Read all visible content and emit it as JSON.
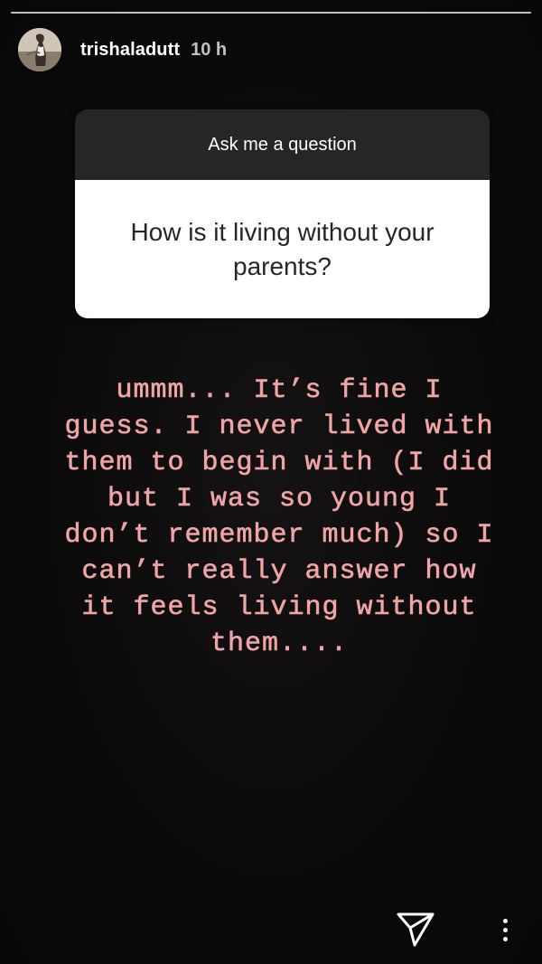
{
  "story": {
    "segments": 1,
    "user": {
      "username": "trishaladutt",
      "time_ago": "10 h"
    }
  },
  "question_sticker": {
    "header": "Ask me a question",
    "question": "How is it living without your parents?"
  },
  "answer": {
    "lines": [
      "ummm... It’s fine I",
      "guess. I never lived with",
      "them to begin with (I did",
      "but I was so young I",
      "don’t remember much) so I",
      "can’t really answer how",
      "it feels living without",
      "them...."
    ],
    "color": "#f0a4a4"
  },
  "icons": {
    "send": "paper-plane-icon",
    "more": "more-vertical-icon"
  }
}
